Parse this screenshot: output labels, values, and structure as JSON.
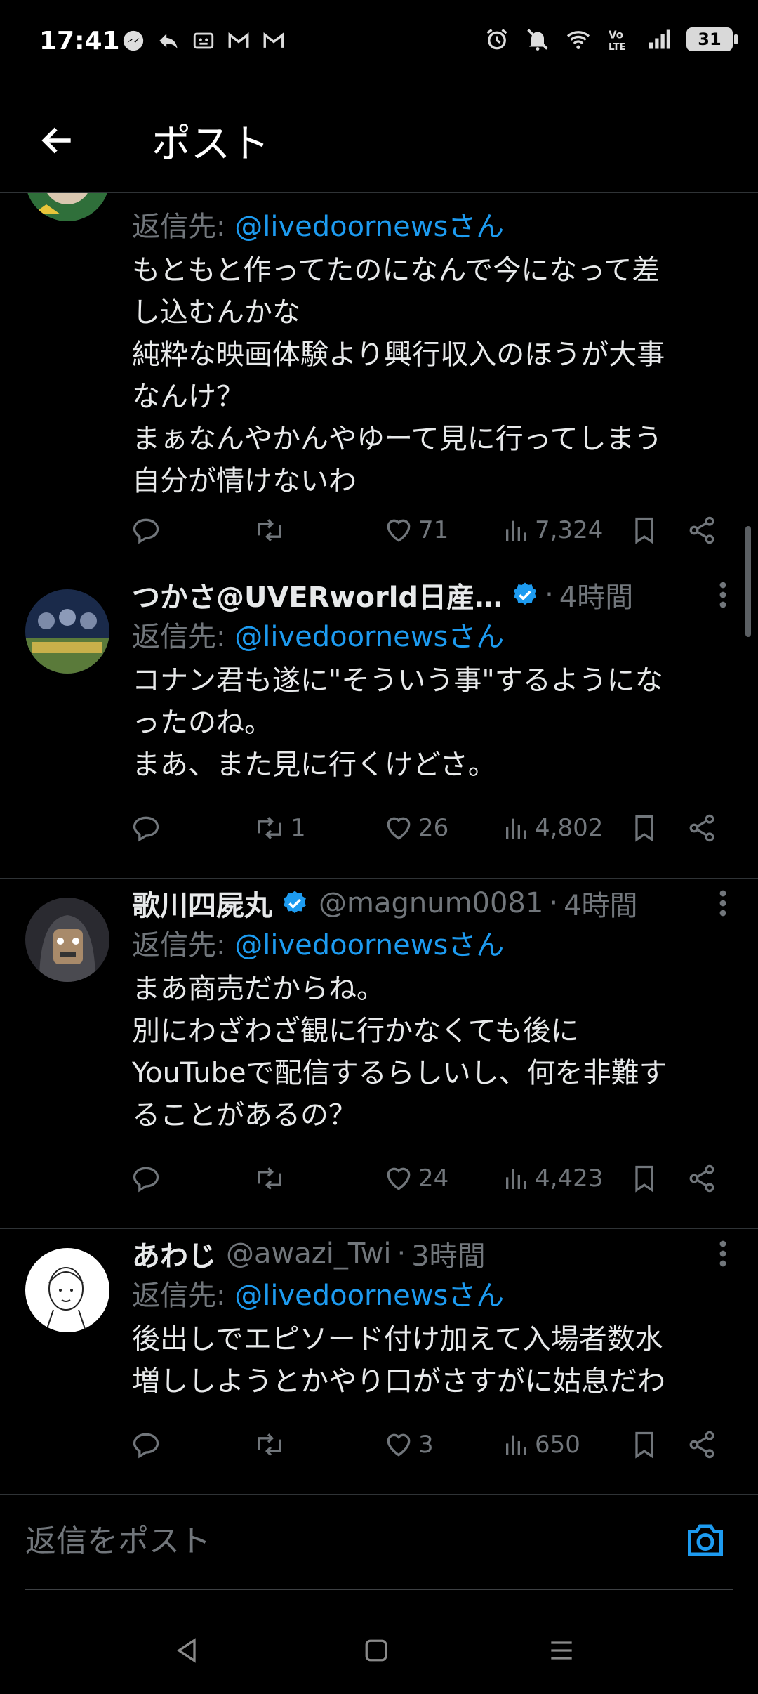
{
  "status_bar": {
    "time": "17:41",
    "battery": "31",
    "left_icons": [
      "messenger-icon",
      "reply-icon",
      "app-icon",
      "gmail-icon",
      "gmail-icon"
    ],
    "right_icons": [
      "alarm-icon",
      "mute-icon",
      "wifi-icon",
      "volte-icon",
      "signal-icon",
      "battery-icon"
    ]
  },
  "header": {
    "title": "ポスト"
  },
  "colors": {
    "accent": "#1d9bf0",
    "background": "#000000",
    "text": "#e7e9ea",
    "muted": "#71767b"
  },
  "tweets": [
    {
      "name": "",
      "handle": "",
      "time": "",
      "reply_prefix": "返信先: ",
      "reply_to": "@livedoornewsさん",
      "lines": [
        "もともと作ってたのになんで今になって差",
        "し込むんかな",
        "純粋な映画体験より興行収入のほうが大事",
        "なんけ？",
        "まぁなんやかんやゆーて見に行ってしまう",
        "自分が情けないわ"
      ],
      "replies": "",
      "retweets": "",
      "likes": "71",
      "views": "7,324"
    },
    {
      "name": "つかさ@UVERworld日産…",
      "handle": "",
      "time": "4時間",
      "reply_prefix": "返信先: ",
      "reply_to": "@livedoornewsさん",
      "lines": [
        "コナン君も遂に\"そういう事\"するようにな",
        "ったのね。",
        "まあ、また見に行くけどさ。"
      ],
      "replies": "",
      "retweets": "1",
      "likes": "26",
      "views": "4,802"
    },
    {
      "name": "歌川四屍丸",
      "handle": "@magnum0081",
      "time": "4時間",
      "reply_prefix": "返信先: ",
      "reply_to": "@livedoornewsさん",
      "lines": [
        "まあ商売だからね。",
        "別にわざわざ観に行かなくても後に",
        "YouTubeで配信するらしいし、何を非難す",
        "ることがあるの？"
      ],
      "replies": "",
      "retweets": "",
      "likes": "24",
      "views": "4,423"
    },
    {
      "name": "あわじ",
      "handle": "@awazi_Twi",
      "time": "3時間",
      "reply_prefix": "返信先: ",
      "reply_to": "@livedoornewsさん",
      "lines": [
        "後出しでエピソード付け加えて入場者数水",
        "増ししようとかやり口がさすがに姑息だわ"
      ],
      "replies": "",
      "retweets": "",
      "likes": "3",
      "views": "650"
    }
  ],
  "compose": {
    "placeholder": "返信をポスト"
  },
  "dot": "·"
}
